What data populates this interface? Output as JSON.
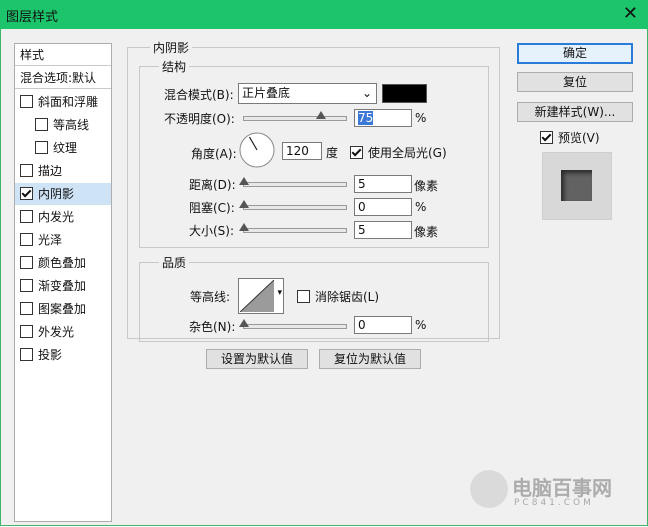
{
  "window": {
    "title": "图层样式"
  },
  "left_panel": {
    "styles_header": "样式",
    "blend_options": "混合选项:默认",
    "items": [
      {
        "label": "斜面和浮雕",
        "checked": false
      },
      {
        "label": "等高线",
        "checked": false
      },
      {
        "label": "纹理",
        "checked": false
      },
      {
        "label": "描边",
        "checked": false
      },
      {
        "label": "内阴影",
        "checked": true
      },
      {
        "label": "内发光",
        "checked": false
      },
      {
        "label": "光泽",
        "checked": false
      },
      {
        "label": "颜色叠加",
        "checked": false
      },
      {
        "label": "渐变叠加",
        "checked": false
      },
      {
        "label": "图案叠加",
        "checked": false
      },
      {
        "label": "外发光",
        "checked": false
      },
      {
        "label": "投影",
        "checked": false
      }
    ]
  },
  "inner_shadow": {
    "section_title": "内阴影",
    "structure_title": "结构",
    "blend_mode_label": "混合模式(B):",
    "blend_mode_value": "正片叠底",
    "shadow_color": "#000000",
    "opacity_label": "不透明度(O):",
    "opacity_value": "75",
    "opacity_fraction": 0.75,
    "percent": "%",
    "angle_label": "角度(A):",
    "angle_value": "120",
    "angle_unit": "度",
    "global_light_label": "使用全局光(G)",
    "global_light_checked": true,
    "distance_label": "距离(D):",
    "distance_value": "5",
    "distance_fraction": 0.0,
    "pixel_unit": "像素",
    "choke_label": "阻塞(C):",
    "choke_value": "0",
    "choke_fraction": 0.0,
    "size_label": "大小(S):",
    "size_value": "5",
    "size_fraction": 0.0
  },
  "quality": {
    "title": "品质",
    "contour_label": "等高线:",
    "antialias_label": "消除锯齿(L)",
    "antialias_checked": false,
    "noise_label": "杂色(N):",
    "noise_value": "0",
    "noise_fraction": 0.0
  },
  "defaults": {
    "set_default": "设置为默认值",
    "reset_default": "复位为默认值"
  },
  "right": {
    "ok": "确定",
    "reset": "复位",
    "new_style": "新建样式(W)...",
    "preview_label": "预览(V)",
    "preview_checked": true
  },
  "watermark": {
    "text": "电脑百事网",
    "sub": "PC841.COM"
  }
}
